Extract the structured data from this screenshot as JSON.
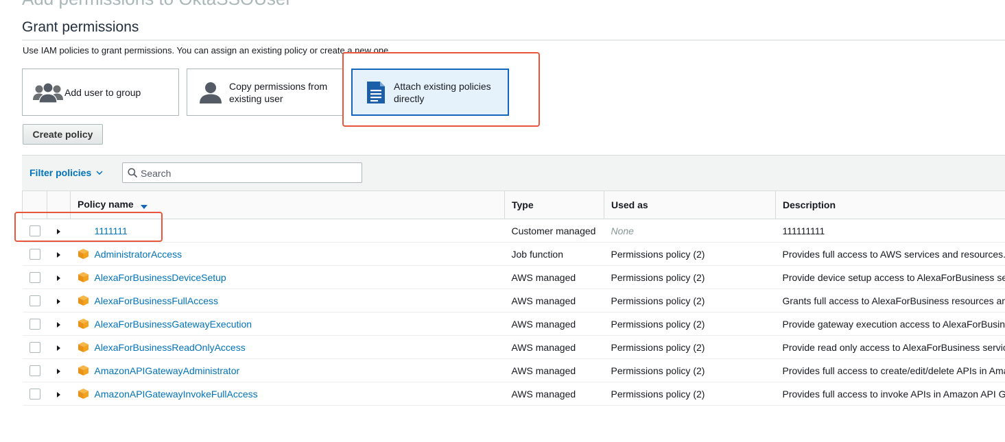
{
  "page": {
    "title": "Add permissions to OktaSSOUser",
    "section_heading": "Grant permissions",
    "help_text": "Use IAM policies to grant permissions. You can assign an existing policy or create a new one."
  },
  "options": {
    "add_group_label": "Add user to group",
    "copy_label": "Copy permissions from existing user",
    "attach_label": "Attach existing policies directly",
    "selected": "attach"
  },
  "create_policy_label": "Create policy",
  "filter": {
    "label": "Filter policies",
    "search_placeholder": "Search"
  },
  "table": {
    "headers": {
      "name": "Policy name",
      "type": "Type",
      "used_as": "Used as",
      "description": "Description"
    },
    "rows": [
      {
        "name": "1111111",
        "type": "Customer managed",
        "used_as": "None",
        "description": "111111111",
        "icon": "none"
      },
      {
        "name": "AdministratorAccess",
        "type": "Job function",
        "used_as": "Permissions policy (2)",
        "description": "Provides full access to AWS services and resources.",
        "icon": "aws-package"
      },
      {
        "name": "AlexaForBusinessDeviceSetup",
        "type": "AWS managed",
        "used_as": "Permissions policy (2)",
        "description": "Provide device setup access to AlexaForBusiness services",
        "icon": "aws-package"
      },
      {
        "name": "AlexaForBusinessFullAccess",
        "type": "AWS managed",
        "used_as": "Permissions policy (2)",
        "description": "Grants full access to AlexaForBusiness resources and access",
        "icon": "aws-package"
      },
      {
        "name": "AlexaForBusinessGatewayExecution",
        "type": "AWS managed",
        "used_as": "Permissions policy (2)",
        "description": "Provide gateway execution access to AlexaForBusiness services",
        "icon": "aws-package"
      },
      {
        "name": "AlexaForBusinessReadOnlyAccess",
        "type": "AWS managed",
        "used_as": "Permissions policy (2)",
        "description": "Provide read only access to AlexaForBusiness services",
        "icon": "aws-package"
      },
      {
        "name": "AmazonAPIGatewayAdministrator",
        "type": "AWS managed",
        "used_as": "Permissions policy (2)",
        "description": "Provides full access to create/edit/delete APIs in Amazon API Gateway",
        "icon": "aws-package"
      },
      {
        "name": "AmazonAPIGatewayInvokeFullAccess",
        "type": "AWS managed",
        "used_as": "Permissions policy (2)",
        "description": "Provides full access to invoke APIs in Amazon API Gateway",
        "icon": "aws-package"
      }
    ]
  },
  "colors": {
    "link": "#0073bb",
    "highlight": "#e8553b",
    "selected_card_bg": "#e6f2fb",
    "selected_card_border": "#1166bb",
    "package_icon": "#f4a31f"
  }
}
